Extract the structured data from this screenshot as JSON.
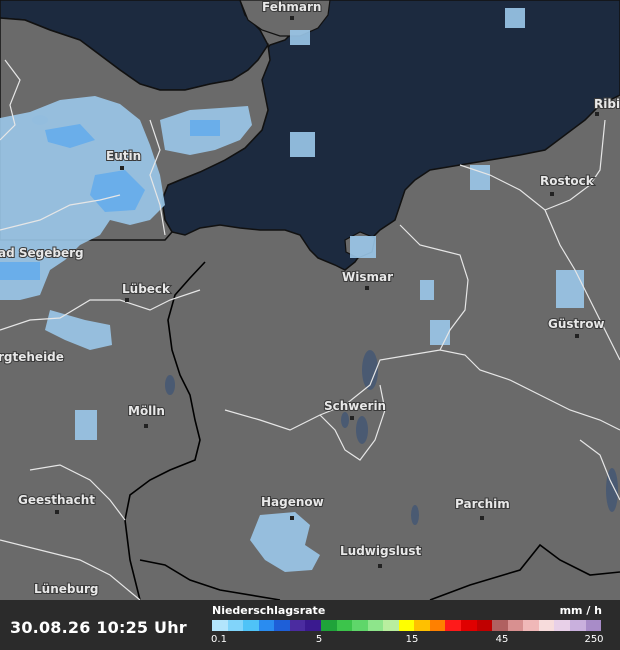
{
  "map": {
    "cities": [
      {
        "name": "Fehmarn"
      },
      {
        "name": "Eutin"
      },
      {
        "name": "ad Segeberg"
      },
      {
        "name": "Lübeck"
      },
      {
        "name": "rgteheide"
      },
      {
        "name": "Wismar"
      },
      {
        "name": "Rostock"
      },
      {
        "name": "Güstrow"
      },
      {
        "name": "Schwerin"
      },
      {
        "name": "Mölln"
      },
      {
        "name": "Geesthacht"
      },
      {
        "name": "Hagenow"
      },
      {
        "name": "Parchim"
      },
      {
        "name": "Ludwigslust"
      },
      {
        "name": "Lüneburg"
      },
      {
        "name": "Ribi"
      }
    ]
  },
  "footer": {
    "timestamp": "30.08.26 10:25 Uhr",
    "legend_title": "Niederschlagsrate",
    "legend_unit": "mm / h",
    "legend_ticks": [
      "0.1",
      "5",
      "15",
      "45",
      "250"
    ],
    "legend_colors": [
      "#b3e5fc",
      "#81d4fa",
      "#4fc3f7",
      "#2a8cf0",
      "#1e5fd8",
      "#4b2ca0",
      "#3a1a8f",
      "#1fa33a",
      "#3cc44b",
      "#5fd66a",
      "#8ee58b",
      "#b9ee9f",
      "#ffff00",
      "#ffc000",
      "#ff8000",
      "#ff1a1a",
      "#e00000",
      "#c00000",
      "#b06060",
      "#d89090",
      "#f0b8b8",
      "#f7dcdc",
      "#e8d0e8",
      "#c9b0dd",
      "#a88cc8"
    ]
  }
}
